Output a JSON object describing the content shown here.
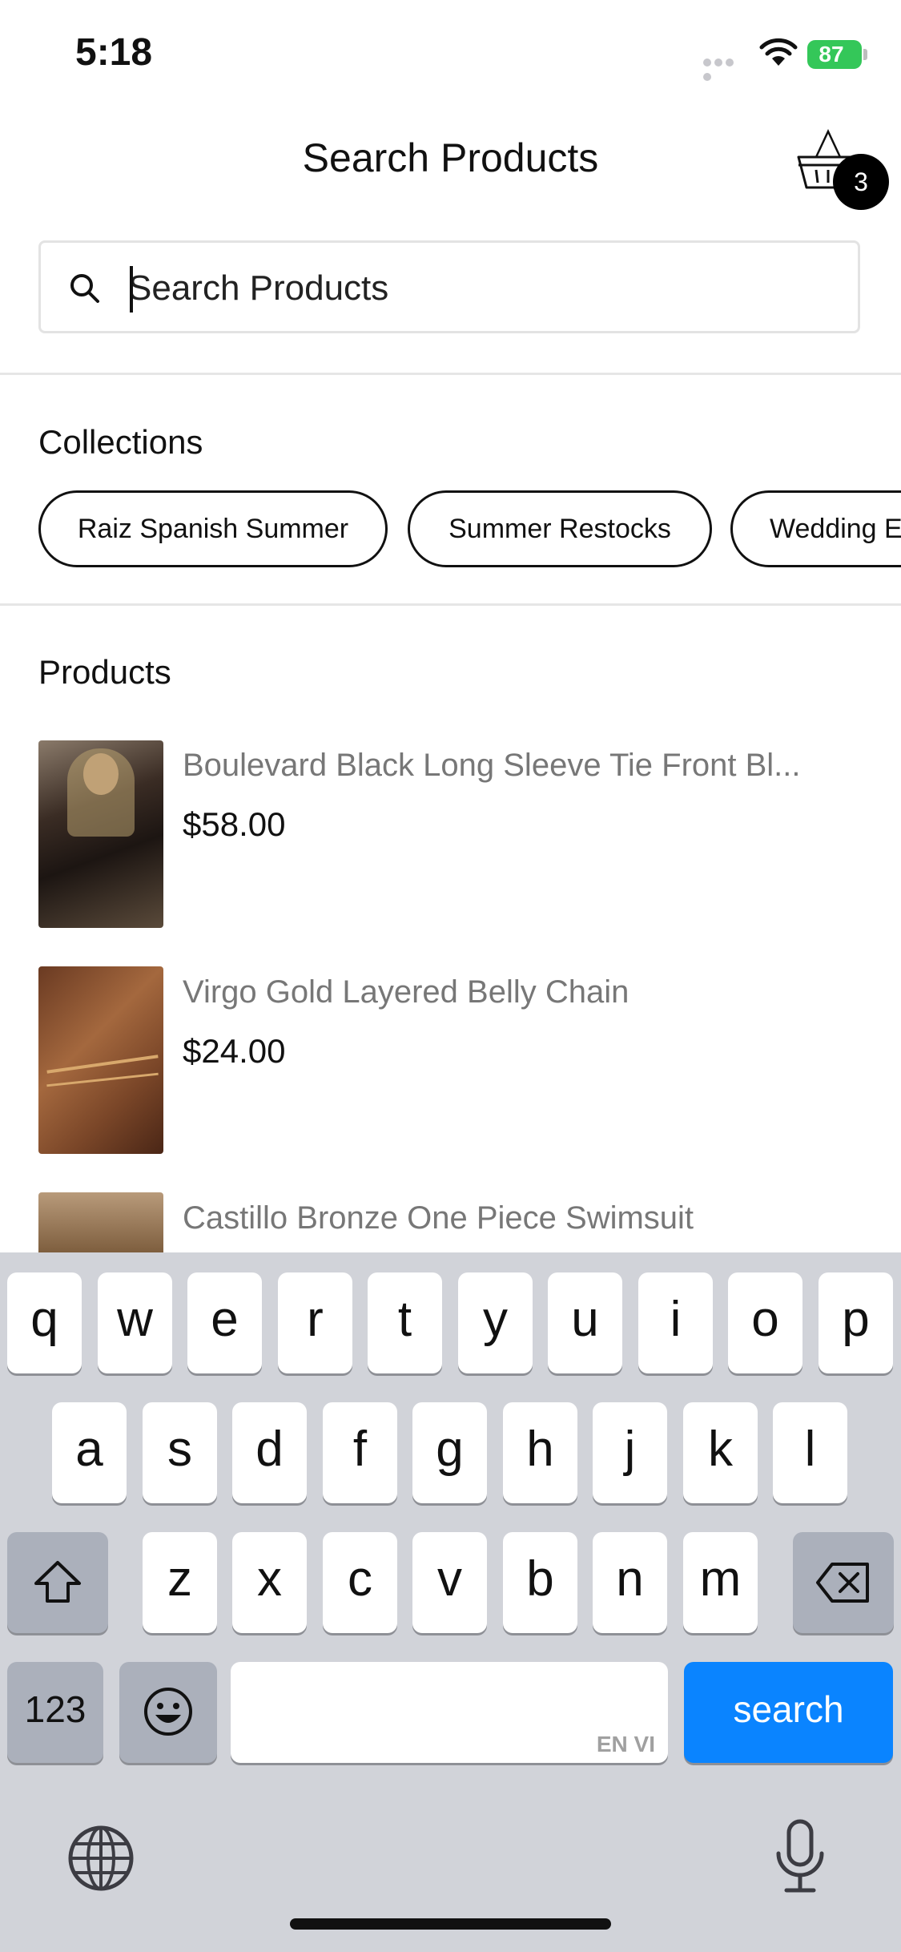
{
  "status_bar": {
    "time": "5:18",
    "battery": "87"
  },
  "header": {
    "title": "Search Products",
    "cart_count": "3"
  },
  "search": {
    "placeholder": "Search Products",
    "value": ""
  },
  "collections": {
    "title": "Collections",
    "items": [
      "Raiz Spanish Summer",
      "Summer Restocks",
      "Wedding E"
    ]
  },
  "products": {
    "title": "Products",
    "items": [
      {
        "name": "Boulevard Black Long Sleeve Tie Front Bl...",
        "price": "$58.00"
      },
      {
        "name": "Virgo Gold Layered Belly Chain",
        "price": "$24.00"
      },
      {
        "name": "Castillo Bronze One Piece Swimsuit",
        "price": ""
      }
    ]
  },
  "keyboard": {
    "row1": [
      "q",
      "w",
      "e",
      "r",
      "t",
      "y",
      "u",
      "i",
      "o",
      "p"
    ],
    "row2": [
      "a",
      "s",
      "d",
      "f",
      "g",
      "h",
      "j",
      "k",
      "l"
    ],
    "row3": [
      "z",
      "x",
      "c",
      "v",
      "b",
      "n",
      "m"
    ],
    "numbers_label": "123",
    "search_label": "search",
    "space_hint": "EN VI"
  },
  "colors": {
    "accent": "#0a84ff",
    "battery": "#34c759",
    "keyboard_bg": "#d1d3d9"
  }
}
